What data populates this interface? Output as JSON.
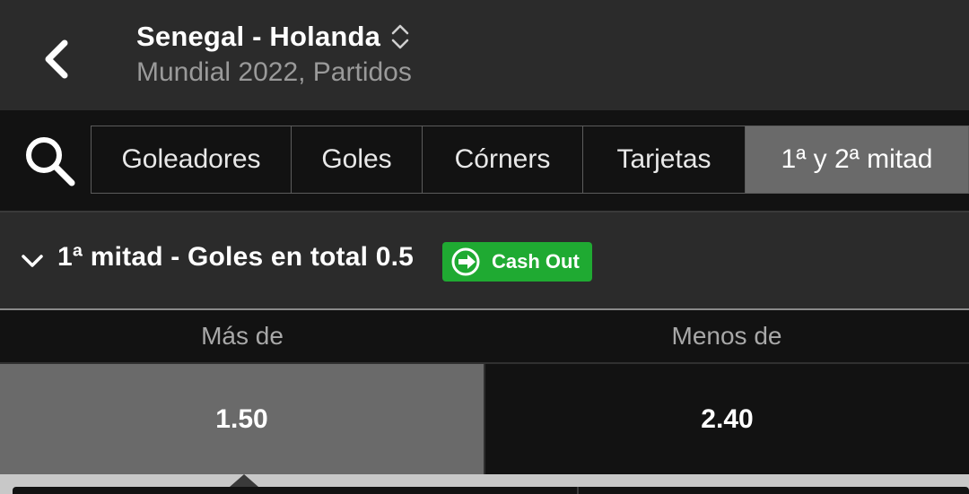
{
  "header": {
    "title": "Senegal - Holanda",
    "subtitle": "Mundial 2022, Partidos",
    "back_icon": "chevron-left-icon",
    "toggle_icon": "sort-updown-icon"
  },
  "tabs": [
    {
      "label": "Goleadores",
      "active": false
    },
    {
      "label": "Goles",
      "active": false
    },
    {
      "label": "Córners",
      "active": false
    },
    {
      "label": "Tarjetas",
      "active": false
    },
    {
      "label": "1ª y 2ª mitad",
      "active": true
    }
  ],
  "search_icon": "search-icon",
  "market": {
    "title": "1ª mitad - Goles en total 0.5",
    "cashout_label": "Cash Out",
    "cashout_color": "#1faa32",
    "columns": [
      "Más de",
      "Menos de"
    ],
    "odds": [
      {
        "value": "1.50",
        "selected": true
      },
      {
        "value": "2.40",
        "selected": false
      }
    ]
  }
}
